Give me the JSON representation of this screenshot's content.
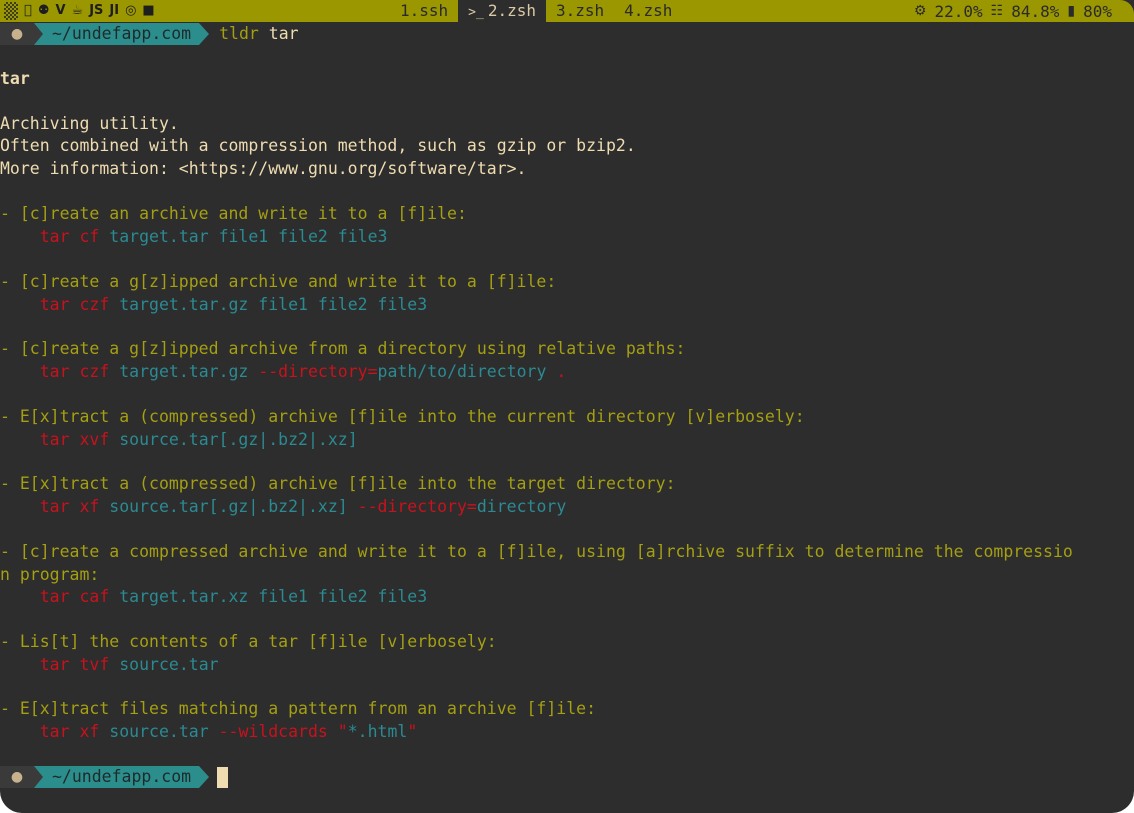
{
  "statusbar": {
    "left_icons": [
      "apple-icon",
      "github-icon",
      "vim-icon",
      "java-icon",
      "js-icon",
      "intellij-icon",
      "chrome-icon",
      "terminal-icon"
    ],
    "left_icon_glyphs": [
      "",
      "⚉",
      "V",
      "☕",
      "JS",
      "JI",
      "◎",
      "■"
    ],
    "tabs": [
      {
        "label": "1.ssh",
        "active": false
      },
      {
        "label": "2.zsh",
        "active": true,
        "glyph": ">_"
      },
      {
        "label": "3.zsh",
        "active": false
      },
      {
        "label": "4.zsh",
        "active": false
      }
    ],
    "cpu": "22.0%",
    "memory": "84.8%",
    "battery": "80%",
    "cpu_glyph": "⚙",
    "memory_glyph": "☷",
    "battery_glyph": "▮"
  },
  "prompt": {
    "apple_glyph": "●",
    "path": "~/undefapp.com",
    "command": "tldr",
    "argument": "tar"
  },
  "page": {
    "title": "tar",
    "description": [
      "Archiving utility.",
      "Often combined with a compression method, such as gzip or bzip2.",
      "More information: <https://www.gnu.org/software/tar>."
    ],
    "examples": [
      {
        "desc": "- [c]reate an archive and write it to a [f]ile:",
        "tokens": [
          {
            "t": "    ",
            "c": ""
          },
          {
            "t": "tar cf",
            "c": "red"
          },
          {
            "t": " target.tar file1 file2 file3",
            "c": "teal"
          }
        ]
      },
      {
        "desc": "- [c]reate a g[z]ipped archive and write it to a [f]ile:",
        "tokens": [
          {
            "t": "    ",
            "c": ""
          },
          {
            "t": "tar czf",
            "c": "red"
          },
          {
            "t": " target.tar.gz file1 file2 file3",
            "c": "teal"
          }
        ]
      },
      {
        "desc": "- [c]reate a g[z]ipped archive from a directory using relative paths:",
        "tokens": [
          {
            "t": "    ",
            "c": ""
          },
          {
            "t": "tar czf",
            "c": "red"
          },
          {
            "t": " target.tar.gz ",
            "c": "teal"
          },
          {
            "t": "--directory=",
            "c": "red"
          },
          {
            "t": "path/to/directory",
            "c": "teal"
          },
          {
            "t": " .",
            "c": "red"
          }
        ]
      },
      {
        "desc": "- E[x]tract a (compressed) archive [f]ile into the current directory [v]erbosely:",
        "tokens": [
          {
            "t": "    ",
            "c": ""
          },
          {
            "t": "tar xvf",
            "c": "red"
          },
          {
            "t": " source.tar[.gz|.bz2|.xz]",
            "c": "teal"
          }
        ]
      },
      {
        "desc": "- E[x]tract a (compressed) archive [f]ile into the target directory:",
        "tokens": [
          {
            "t": "    ",
            "c": ""
          },
          {
            "t": "tar xf",
            "c": "red"
          },
          {
            "t": " source.tar[.gz|.bz2|.xz] ",
            "c": "teal"
          },
          {
            "t": "--directory=",
            "c": "red"
          },
          {
            "t": "directory",
            "c": "teal"
          }
        ]
      },
      {
        "desc": "- [c]reate a compressed archive and write it to a [f]ile, using [a]rchive suffix to determine the compressio",
        "desc_wrap": "n program:",
        "tokens": [
          {
            "t": "    ",
            "c": ""
          },
          {
            "t": "tar caf",
            "c": "red"
          },
          {
            "t": " target.tar.xz file1 file2 file3",
            "c": "teal"
          }
        ]
      },
      {
        "desc": "- Lis[t] the contents of a tar [f]ile [v]erbosely:",
        "tokens": [
          {
            "t": "    ",
            "c": ""
          },
          {
            "t": "tar tvf",
            "c": "red"
          },
          {
            "t": " source.tar",
            "c": "teal"
          }
        ]
      },
      {
        "desc": "- E[x]tract files matching a pattern from an archive [f]ile:",
        "tokens": [
          {
            "t": "    ",
            "c": ""
          },
          {
            "t": "tar xf",
            "c": "red"
          },
          {
            "t": " source.tar ",
            "c": "teal"
          },
          {
            "t": "--wildcards \"",
            "c": "red"
          },
          {
            "t": "*.html",
            "c": "teal"
          },
          {
            "t": "\"",
            "c": "red"
          }
        ]
      }
    ]
  },
  "prompt_bottom": {
    "path": "~/undefapp.com"
  },
  "colors": {
    "statusbar_bg": "#9b9700",
    "terminal_bg": "#2d2d2d",
    "text": "#efdcb1",
    "example_desc": "#a59f12",
    "command": "#c8121d",
    "argument": "#2b8a92",
    "prompt_path_bg": "#2b8e8c"
  }
}
